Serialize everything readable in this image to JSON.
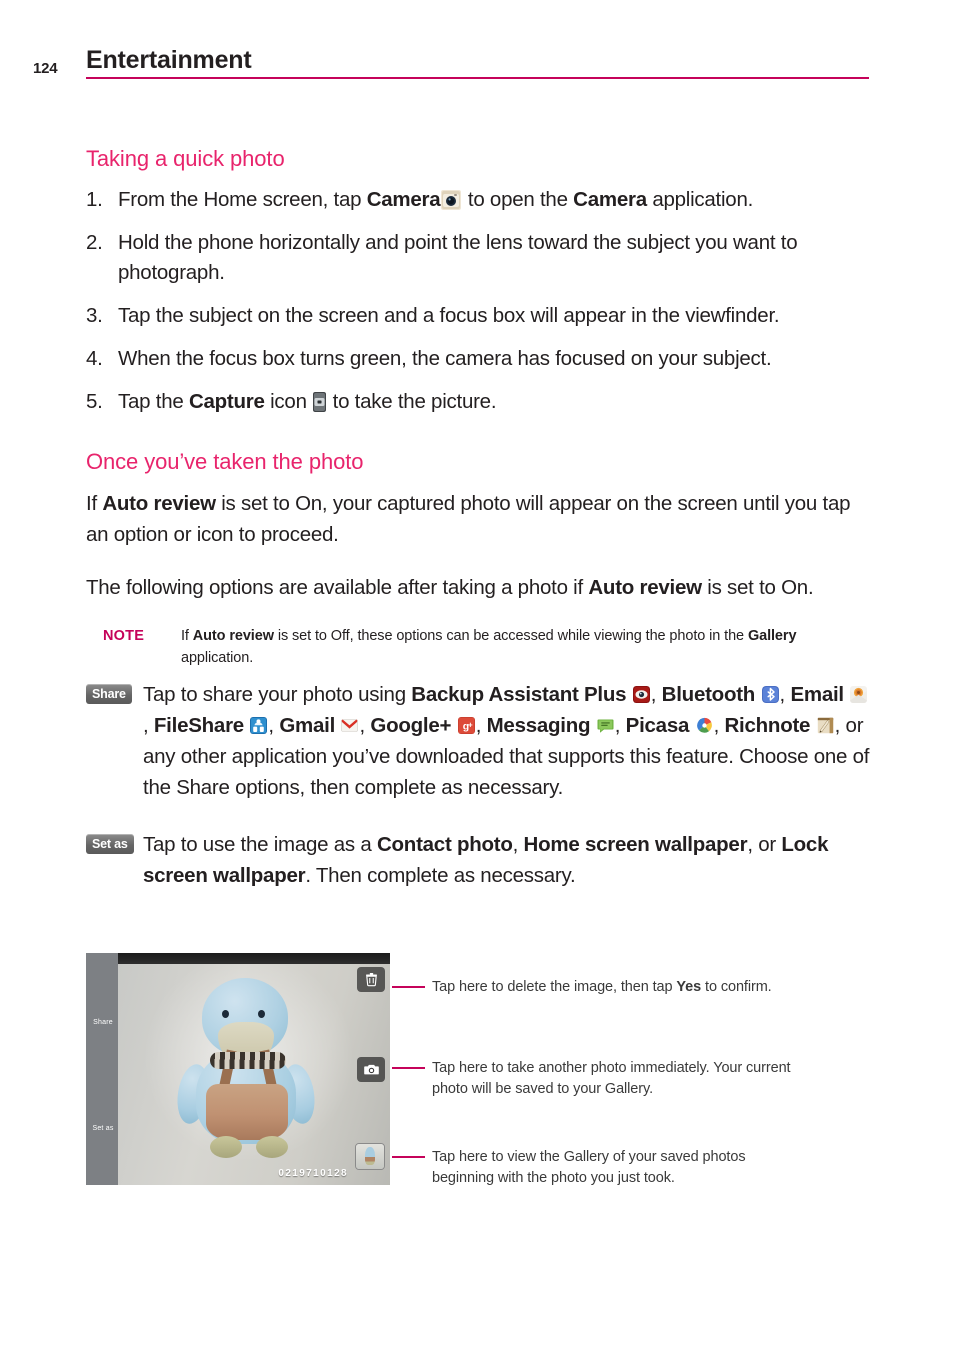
{
  "header": {
    "page_number": "124",
    "title": "Entertainment",
    "rule_color": "#c5035a"
  },
  "sections": {
    "quick_photo": {
      "heading": "Taking a quick photo",
      "steps": [
        {
          "num": "1.",
          "pre": "From the Home screen, tap ",
          "bold1": "Camera",
          "mid": " to open the ",
          "bold2": "Camera",
          "post": " application."
        },
        {
          "num": "2.",
          "text": "Hold the phone horizontally and point the lens toward the subject you want to photograph."
        },
        {
          "num": "3.",
          "text": "Tap the subject on the screen and a focus box will appear in the viewfinder."
        },
        {
          "num": "4.",
          "text": "When the focus box turns green, the camera has focused on your subject."
        },
        {
          "num": "5.",
          "pre": "Tap the ",
          "bold1": "Capture",
          "mid": " icon ",
          "post": " to take the picture."
        }
      ]
    },
    "once_taken": {
      "heading": "Once you’ve taken the photo",
      "p1_a": "If ",
      "p1_bold": "Auto review",
      "p1_b": " is set to On, your captured photo will appear on the screen until you tap an option or icon to proceed.",
      "p2_a": "The following options are available after taking a photo if ",
      "p2_bold": "Auto review",
      "p2_b": " is set to On."
    },
    "note": {
      "label": "NOTE",
      "a": "If ",
      "bold1": "Auto review",
      "b": " is set to Off, these options can be accessed while viewing the photo in the ",
      "bold2": "Gallery",
      "c": " application."
    },
    "share_option": {
      "badge": "Share",
      "t0": "Tap to share your photo using ",
      "app1": "Backup Assistant Plus",
      "sep1": ", ",
      "app2": "Bluetooth",
      "sep2": ", ",
      "app3": "Email",
      "sep3": ", ",
      "app4": "FileShare",
      "sep4": ", ",
      "app5": "Gmail",
      "sep5": ", ",
      "app6": "Google+",
      "sep6": ", ",
      "app7": "Messaging",
      "sep7": ", ",
      "app8": "Picasa",
      "sep8": ", ",
      "app9": "Richnote",
      "tail": ", or any other application you’ve downloaded that supports this feature. Choose one of the Share options, then complete as necessary."
    },
    "setas_option": {
      "badge": "Set as",
      "t0": "Tap to use the image as a ",
      "b1": "Contact photo",
      "s1": ", ",
      "b2": "Home screen wallpaper",
      "s2": ", or ",
      "b3": "Lock screen wallpaper",
      "tail": ". Then complete as necessary."
    }
  },
  "figure": {
    "screenshot": {
      "left_labels": {
        "share": "Share",
        "set_as": "Set as"
      },
      "photo_stamp": "0219710128",
      "buttons": [
        {
          "name": "delete-button",
          "icon": "trash-icon"
        },
        {
          "name": "camera-button",
          "icon": "camera-icon"
        },
        {
          "name": "gallery-button",
          "icon": "gallery-thumbnail-icon"
        }
      ]
    },
    "callouts": [
      {
        "a": "Tap here to delete the image, then tap ",
        "bold": "Yes",
        "b": " to confirm."
      },
      {
        "text": "Tap here to take another photo immediately. Your current\nphoto will be saved to your Gallery."
      },
      {
        "text": "Tap here to view the Gallery of your saved photos\nbeginning with the photo you just took."
      }
    ]
  },
  "colors": {
    "heading_pink": "#e8246c",
    "note_pink": "#c5035a",
    "rule_pink": "#c5035a",
    "body_text": "#231f20",
    "badge_gray": "#666666"
  }
}
